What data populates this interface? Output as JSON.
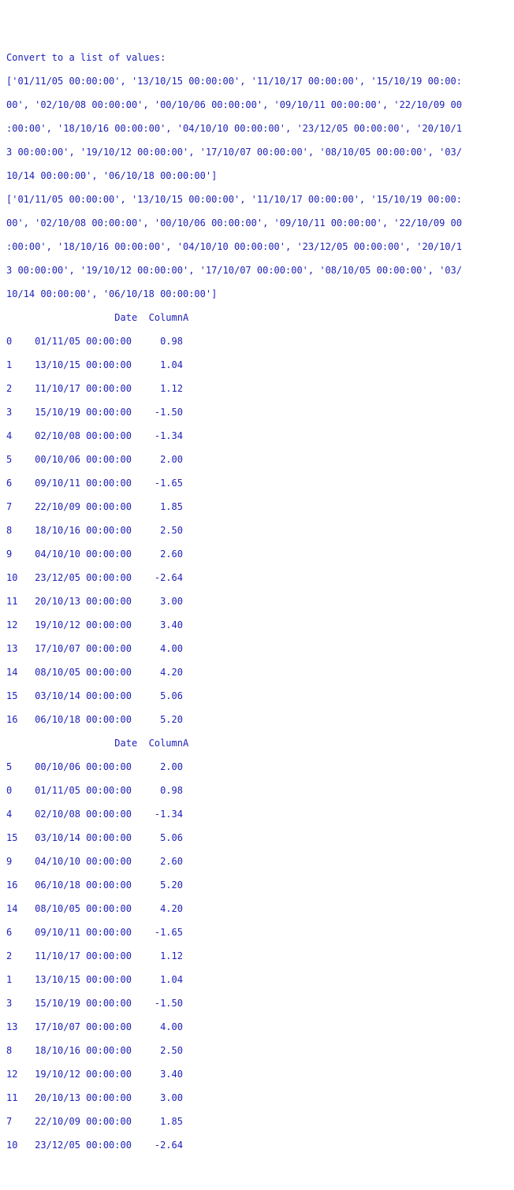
{
  "heading": "Convert to a list of values:",
  "list_block_1": [
    "['01/11/05 00:00:00', '13/10/15 00:00:00', '11/10/17 00:00:00', '15/10/19 00:00:",
    "00', '02/10/08 00:00:00', '00/10/06 00:00:00', '09/10/11 00:00:00', '22/10/09 00",
    ":00:00', '18/10/16 00:00:00', '04/10/10 00:00:00', '23/12/05 00:00:00', '20/10/1",
    "3 00:00:00', '19/10/12 00:00:00', '17/10/07 00:00:00', '08/10/05 00:00:00', '03/",
    "10/14 00:00:00', '06/10/18 00:00:00']"
  ],
  "list_block_2": [
    "['01/11/05 00:00:00', '13/10/15 00:00:00', '11/10/17 00:00:00', '15/10/19 00:00:",
    "00', '02/10/08 00:00:00', '00/10/06 00:00:00', '09/10/11 00:00:00', '22/10/09 00",
    ":00:00', '18/10/16 00:00:00', '04/10/10 00:00:00', '23/12/05 00:00:00', '20/10/1",
    "3 00:00:00', '19/10/12 00:00:00', '17/10/07 00:00:00', '08/10/05 00:00:00', '03/",
    "10/14 00:00:00', '06/10/18 00:00:00']"
  ],
  "table1_header": "                   Date  ColumnA",
  "table1_rows": [
    "0    01/11/05 00:00:00     0.98",
    "1    13/10/15 00:00:00     1.04",
    "2    11/10/17 00:00:00     1.12",
    "3    15/10/19 00:00:00    -1.50",
    "4    02/10/08 00:00:00    -1.34",
    "5    00/10/06 00:00:00     2.00",
    "6    09/10/11 00:00:00    -1.65",
    "7    22/10/09 00:00:00     1.85",
    "8    18/10/16 00:00:00     2.50",
    "9    04/10/10 00:00:00     2.60",
    "10   23/12/05 00:00:00    -2.64",
    "11   20/10/13 00:00:00     3.00",
    "12   19/10/12 00:00:00     3.40",
    "13   17/10/07 00:00:00     4.00",
    "14   08/10/05 00:00:00     4.20",
    "15   03/10/14 00:00:00     5.06",
    "16   06/10/18 00:00:00     5.20"
  ],
  "table2_header": "                   Date  ColumnA",
  "table2_rows": [
    "5    00/10/06 00:00:00     2.00",
    "0    01/11/05 00:00:00     0.98",
    "4    02/10/08 00:00:00    -1.34",
    "15   03/10/14 00:00:00     5.06",
    "9    04/10/10 00:00:00     2.60",
    "16   06/10/18 00:00:00     5.20",
    "14   08/10/05 00:00:00     4.20",
    "6    09/10/11 00:00:00    -1.65",
    "2    11/10/17 00:00:00     1.12",
    "1    13/10/15 00:00:00     1.04",
    "3    15/10/19 00:00:00    -1.50",
    "13   17/10/07 00:00:00     4.00",
    "8    18/10/16 00:00:00     2.50",
    "12   19/10/12 00:00:00     3.40",
    "11   20/10/13 00:00:00     3.00",
    "7    22/10/09 00:00:00     1.85",
    "10   23/12/05 00:00:00    -2.64"
  ]
}
